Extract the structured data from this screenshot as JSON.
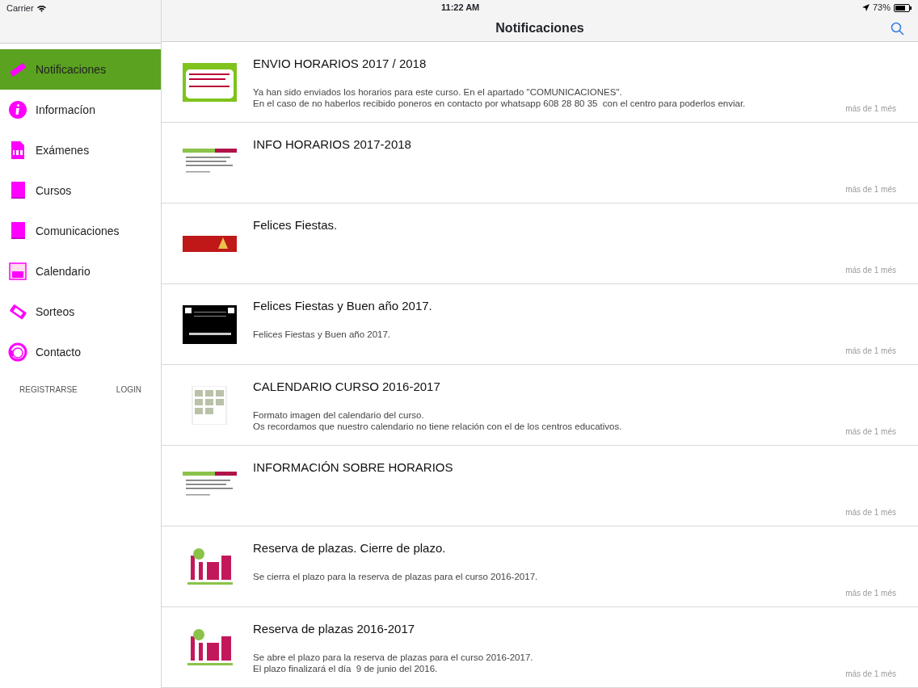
{
  "status_bar": {
    "carrier": "Carrier",
    "time": "11:22 AM",
    "battery": "73%"
  },
  "nav_bar": {
    "title": "Notificaciones"
  },
  "sidebar": {
    "items": [
      {
        "label": "Notificaciones",
        "selected": true
      },
      {
        "label": "Informacíon",
        "selected": false
      },
      {
        "label": "Exámenes",
        "selected": false
      },
      {
        "label": "Cursos",
        "selected": false
      },
      {
        "label": "Comunicaciones",
        "selected": false
      },
      {
        "label": "Calendario",
        "selected": false
      },
      {
        "label": "Sorteos",
        "selected": false
      },
      {
        "label": "Contacto",
        "selected": false
      }
    ],
    "links": [
      "REGISTRARSE",
      "LOGIN"
    ]
  },
  "notifications": [
    {
      "kind": "poster",
      "title": "ENVIO HORARIOS 2017 / 2018",
      "body": [
        "Ya han sido enviados los horarios para este curso. En el apartado \"COMUNICACIONES\".",
        "En el caso de no haberlos recibido poneros en contacto por whatsapp 608 28 80 35  con el centro para poderlos enviar."
      ],
      "time": "más de 1 més"
    },
    {
      "kind": "document",
      "title": "INFO HORARIOS 2017-2018",
      "time": "más de 1 més"
    },
    {
      "kind": "banner",
      "title": "Felices Fiestas.",
      "time": "más de 1 més"
    },
    {
      "kind": "dark-card",
      "title": "Felices Fiestas y Buen año 2017.",
      "body": [
        "Felices Fiestas y Buen año 2017."
      ],
      "time": "más de 1 més"
    },
    {
      "kind": "calendar",
      "title": "CALENDARIO CURSO 2016-2017",
      "body": [
        "Formato imagen del calendario del curso.",
        "Os recordamos que nuestro calendario no tiene relación con el de los centros educativos."
      ],
      "time": "más de 1 més"
    },
    {
      "kind": "document",
      "title": "INFORMACIÓN SOBRE HORARIOS",
      "time": "más de 1 més"
    },
    {
      "kind": "logo",
      "title": "Reserva de plazas. Cierre de plazo.",
      "body": [
        "Se cierra el plazo para la reserva de plazas para el curso 2016-2017."
      ],
      "time": "más de 1 més"
    },
    {
      "kind": "logo",
      "title": "Reserva de plazas 2016-2017",
      "body": [
        "Se abre el plazo para la reserva de plazas para el curso 2016-2017.",
        "El plazo finalizará el día  9 de junio del 2016."
      ],
      "time": "más de 1 més"
    }
  ]
}
